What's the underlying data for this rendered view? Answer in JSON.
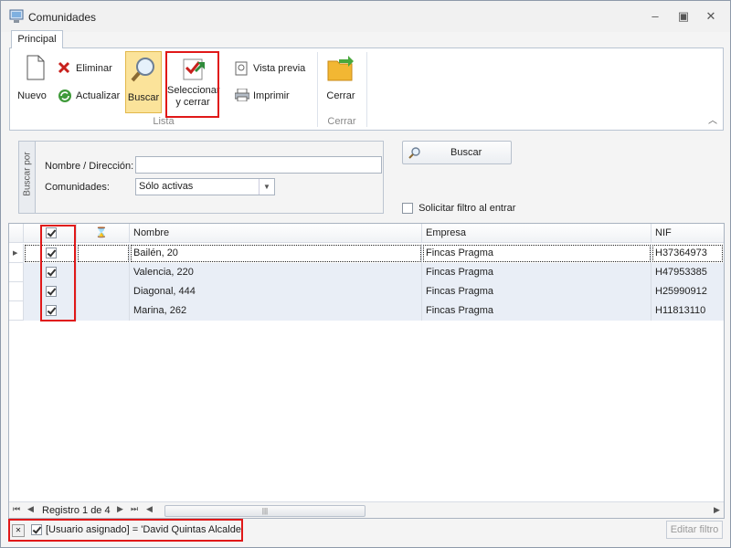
{
  "window": {
    "title": "Comunidades"
  },
  "ribbon": {
    "tab": "Principal",
    "buttons": {
      "nuevo": "Nuevo",
      "eliminar": "Eliminar",
      "actualizar": "Actualizar",
      "buscar": "Buscar",
      "seleccionar_1": "Seleccionar",
      "seleccionar_2": "y cerrar",
      "vista_previa": "Vista previa",
      "imprimir": "Imprimir",
      "cerrar": "Cerrar"
    },
    "groups": {
      "lista": "Lista",
      "cerrar": "Cerrar"
    }
  },
  "search": {
    "panel_label": "Buscar por",
    "name_label": "Nombre / Dirección:",
    "name_value": "",
    "communities_label": "Comunidades:",
    "communities_value": "Sólo activas",
    "button": "Buscar",
    "filter_on_enter": "Solicitar filtro al entrar"
  },
  "grid": {
    "columns": [
      "Nombre",
      "Empresa",
      "NIF"
    ],
    "rows": [
      {
        "nombre": "Bailén, 20",
        "empresa": "Fincas Pragma",
        "nif": "H37364973",
        "checked": true
      },
      {
        "nombre": "Valencia, 220",
        "empresa": "Fincas Pragma",
        "nif": "H47953385",
        "checked": true
      },
      {
        "nombre": "Diagonal, 444",
        "empresa": "Fincas Pragma",
        "nif": "H25990912",
        "checked": true
      },
      {
        "nombre": "Marina, 262",
        "empresa": "Fincas Pragma",
        "nif": "H11813110",
        "checked": true
      }
    ],
    "record_nav": "Registro 1 de 4"
  },
  "filter": {
    "text": "[Usuario asignado] = 'David Quintas Alcalde'",
    "edit_button": "Editar filtro"
  },
  "colors": {
    "highlight": "#e01818",
    "selected_button": "#fbe39a"
  }
}
